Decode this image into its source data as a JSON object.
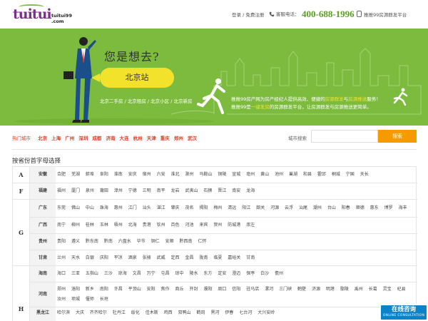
{
  "header": {
    "logo_mark": "tuitui",
    "logo_domain": "tuitui99\n.com",
    "login": "登录 / 免费注册",
    "phone_label": "客服电话：",
    "phone": "400-688-1996",
    "platform": "推推99房源群发平台"
  },
  "hero": {
    "question": "您是想去?",
    "station": "北京站",
    "links": "北京二手房 / 北京租房 / 北京小区 / 北京新房",
    "desc_line1_a": "推推99房产网为房产经纪人提供高效、便捷的",
    "desc_line1_b": "房源群发",
    "desc_line1_c": "与",
    "desc_line1_d": "房源推送",
    "desc_line1_e": "服务！",
    "desc_line2_a": "推推99是",
    "desc_line2_b": "一键发房",
    "desc_line2_c": "的房源群发平台，让房源群发与房源推送更简单。"
  },
  "search": {
    "hot_label": "热门城市",
    "hot_cities": [
      "北京",
      "上海",
      "广州",
      "深圳",
      "成都",
      "济南",
      "大连",
      "杭州",
      "天津",
      "重庆",
      "郑州",
      "武汉"
    ],
    "label": "城市搜索",
    "placeholder": "",
    "button": "搜索"
  },
  "section_title": "按省份首字母选择",
  "groups": [
    {
      "letter": "A",
      "rows": [
        {
          "prov": "安徽",
          "cities": [
            "合肥",
            "芜湖",
            "蚌埠",
            "阜阳",
            "淮南",
            "安庆",
            "宿州",
            "六安",
            "淮北",
            "滁州",
            "马鞍山",
            "铜陵",
            "宣城",
            "亳州",
            "黄山",
            "池州",
            "巢湖",
            "和县",
            "霍邱",
            "桐城",
            "宁国",
            "天长"
          ]
        }
      ]
    },
    {
      "letter": "F",
      "rows": [
        {
          "prov": "福建",
          "cities": [
            "福州",
            "厦门",
            "泉州",
            "莆田",
            "漳州",
            "宁德",
            "三明",
            "南平",
            "龙岩",
            "武夷山",
            "石狮",
            "晋江",
            "南安",
            "龙海"
          ]
        }
      ]
    },
    {
      "letter": "G",
      "rows": [
        {
          "prov": "广东",
          "cities": [
            "东莞",
            "佛山",
            "中山",
            "珠海",
            "惠州",
            "江门",
            "汕头",
            "湛江",
            "肇庆",
            "茂名",
            "揭阳",
            "梅州",
            "清远",
            "阳江",
            "韶关",
            "河源",
            "云浮",
            "汕尾",
            "潮州",
            "台山",
            "阳春",
            "顺德",
            "惠东",
            "博罗",
            "海丰"
          ]
        },
        {
          "prov": "广西",
          "cities": [
            "南宁",
            "柳州",
            "桂林",
            "玉林",
            "梧州",
            "北海",
            "贵港",
            "钦州",
            "百色",
            "河池",
            "来宾",
            "贺州",
            "防城港",
            "崇左"
          ]
        },
        {
          "prov": "贵州",
          "cities": [
            "贵阳",
            "遵义",
            "黔东南",
            "黔南",
            "六盘水",
            "毕节",
            "铜仁",
            "安顺",
            "黔西南",
            "仁怀"
          ]
        },
        {
          "prov": "甘肃",
          "cities": [
            "兰州",
            "天水",
            "白银",
            "庆阳",
            "平凉",
            "酒泉",
            "张掖",
            "武威",
            "定西",
            "金昌",
            "陇南",
            "临夏",
            "嘉峪关",
            "甘南"
          ]
        }
      ]
    },
    {
      "letter": "H",
      "rows": [
        {
          "prov": "海南",
          "cities": [
            "海口",
            "三亚",
            "五指山",
            "三沙",
            "琼海",
            "文昌",
            "万宁",
            "屯昌",
            "琼中",
            "陵水",
            "东方",
            "定安",
            "澄迈",
            "保亭",
            "白沙",
            "儋州"
          ]
        },
        {
          "prov": "河南",
          "cities": [
            "郑州",
            "洛阳",
            "新乡",
            "南阳",
            "许昌",
            "平顶山",
            "安阳",
            "焦作",
            "商丘",
            "开封",
            "濮阳",
            "周口",
            "信阳",
            "驻马店",
            "漯河",
            "三门峡",
            "鹤壁",
            "济源",
            "明港",
            "鄢陵",
            "禹州",
            "长葛",
            "灵宝",
            "杞县",
            "汝州",
            "项城",
            "偃师",
            "长垣"
          ]
        },
        {
          "prov": "黑龙江",
          "cities": [
            "哈尔滨",
            "大庆",
            "齐齐哈尔",
            "牡丹江",
            "绥化",
            "佳木斯",
            "鸡西",
            "双鸭山",
            "鹤岗",
            "黑河",
            "伊春",
            "七台河",
            "大兴安岭"
          ]
        }
      ]
    }
  ],
  "consult": {
    "main": "在线咨询",
    "sub": "ONLINE CONSULTATION"
  },
  "colors": {
    "hero_green": "#7dbb3e",
    "accent_yellow": "#f3e22c",
    "phone_green": "#5a9e22",
    "hot_red": "#e03b1f",
    "search_orange": "#f59b00",
    "consult_blue": "#0a83c9",
    "logo_purple": "#7a2f8e"
  }
}
